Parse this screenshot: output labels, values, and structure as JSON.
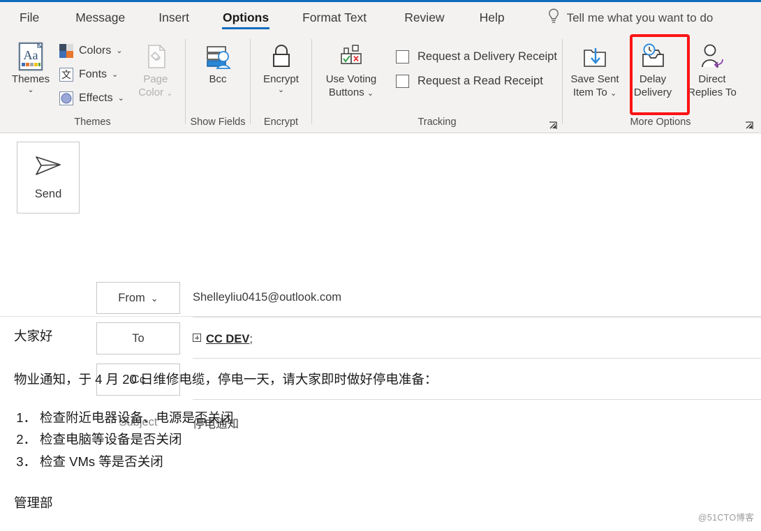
{
  "theme": {
    "accent": "#0f6cbd",
    "ribbon_bg": "#f3f2f1",
    "annotation_color": "#fc1414"
  },
  "tabs": [
    {
      "label": "File",
      "active": false
    },
    {
      "label": "Message",
      "active": false
    },
    {
      "label": "Insert",
      "active": false
    },
    {
      "label": "Options",
      "active": true
    },
    {
      "label": "Format Text",
      "active": false
    },
    {
      "label": "Review",
      "active": false
    },
    {
      "label": "Help",
      "active": false
    }
  ],
  "tell_me": {
    "icon": "lightbulb-icon",
    "text": "Tell me what you want to do"
  },
  "ribbon": {
    "groups": [
      {
        "name": "themes",
        "label": "Themes",
        "buttons": [
          {
            "label": "Themes",
            "icon": "themes-icon",
            "has_chevron": true,
            "disabled": false
          },
          {
            "label": "Colors",
            "icon": "colors-icon",
            "has_chevron": true,
            "disabled": false
          },
          {
            "label": "Fonts",
            "icon": "fonts-icon",
            "has_chevron": true,
            "disabled": false
          },
          {
            "label": "Effects",
            "icon": "effects-icon",
            "has_chevron": true,
            "disabled": false
          },
          {
            "label": "Page Color",
            "icon": "page-color-icon",
            "has_chevron": true,
            "disabled": true
          }
        ]
      },
      {
        "name": "show-fields",
        "label": "Show Fields",
        "buttons": [
          {
            "label": "Bcc",
            "icon": "bcc-icon",
            "has_chevron": false,
            "disabled": false
          }
        ]
      },
      {
        "name": "encrypt",
        "label": "Encrypt",
        "buttons": [
          {
            "label": "Encrypt",
            "icon": "lock-icon",
            "has_chevron": true,
            "disabled": false
          }
        ]
      },
      {
        "name": "tracking",
        "label": "Tracking",
        "has_dialog_launcher": true,
        "buttons": [
          {
            "label": "Use Voting Buttons",
            "icon": "voting-buttons-icon",
            "has_chevron": true,
            "disabled": false
          }
        ],
        "checkboxes": [
          {
            "label": "Request a Delivery Receipt",
            "checked": false
          },
          {
            "label": "Request a Read Receipt",
            "checked": false
          }
        ]
      },
      {
        "name": "more-options",
        "label": "More Options",
        "has_dialog_launcher": true,
        "buttons": [
          {
            "label": "Save Sent Item To",
            "icon": "save-sent-item-icon",
            "has_chevron": true,
            "disabled": false,
            "highlighted": false
          },
          {
            "label": "Delay Delivery",
            "icon": "delay-delivery-icon",
            "has_chevron": false,
            "disabled": false,
            "highlighted": true
          },
          {
            "label": "Direct Replies To",
            "icon": "direct-replies-icon",
            "has_chevron": false,
            "disabled": false,
            "highlighted": false
          }
        ]
      }
    ]
  },
  "compose": {
    "send_button": {
      "label": "Send",
      "icon": "send-icon"
    },
    "from": {
      "button_label": "From",
      "value": "Shelleyliu0415@outlook.com",
      "has_chevron": true
    },
    "to": {
      "button_label": "To",
      "value": "CC DEV",
      "separator": ";",
      "expand_icon": "expand-recipient-icon"
    },
    "cc": {
      "button_label": "Cc",
      "value": ""
    },
    "subject": {
      "label": "Subject",
      "value": "停电通知"
    }
  },
  "body": {
    "greeting": "大家好",
    "paragraph": "物业通知，于 4 月 20 日维修电缆，停电一天，请大家即时做好停电准备：",
    "list": [
      {
        "num": "1．",
        "text": "检查附近电器设备、电源是否关闭"
      },
      {
        "num": "2．",
        "text": "检查电脑等设备是否关闭"
      },
      {
        "num": "3．",
        "text": "检查 VMs 等是否关闭"
      }
    ],
    "signature": "管理部"
  },
  "watermark": "@51CTO博客"
}
